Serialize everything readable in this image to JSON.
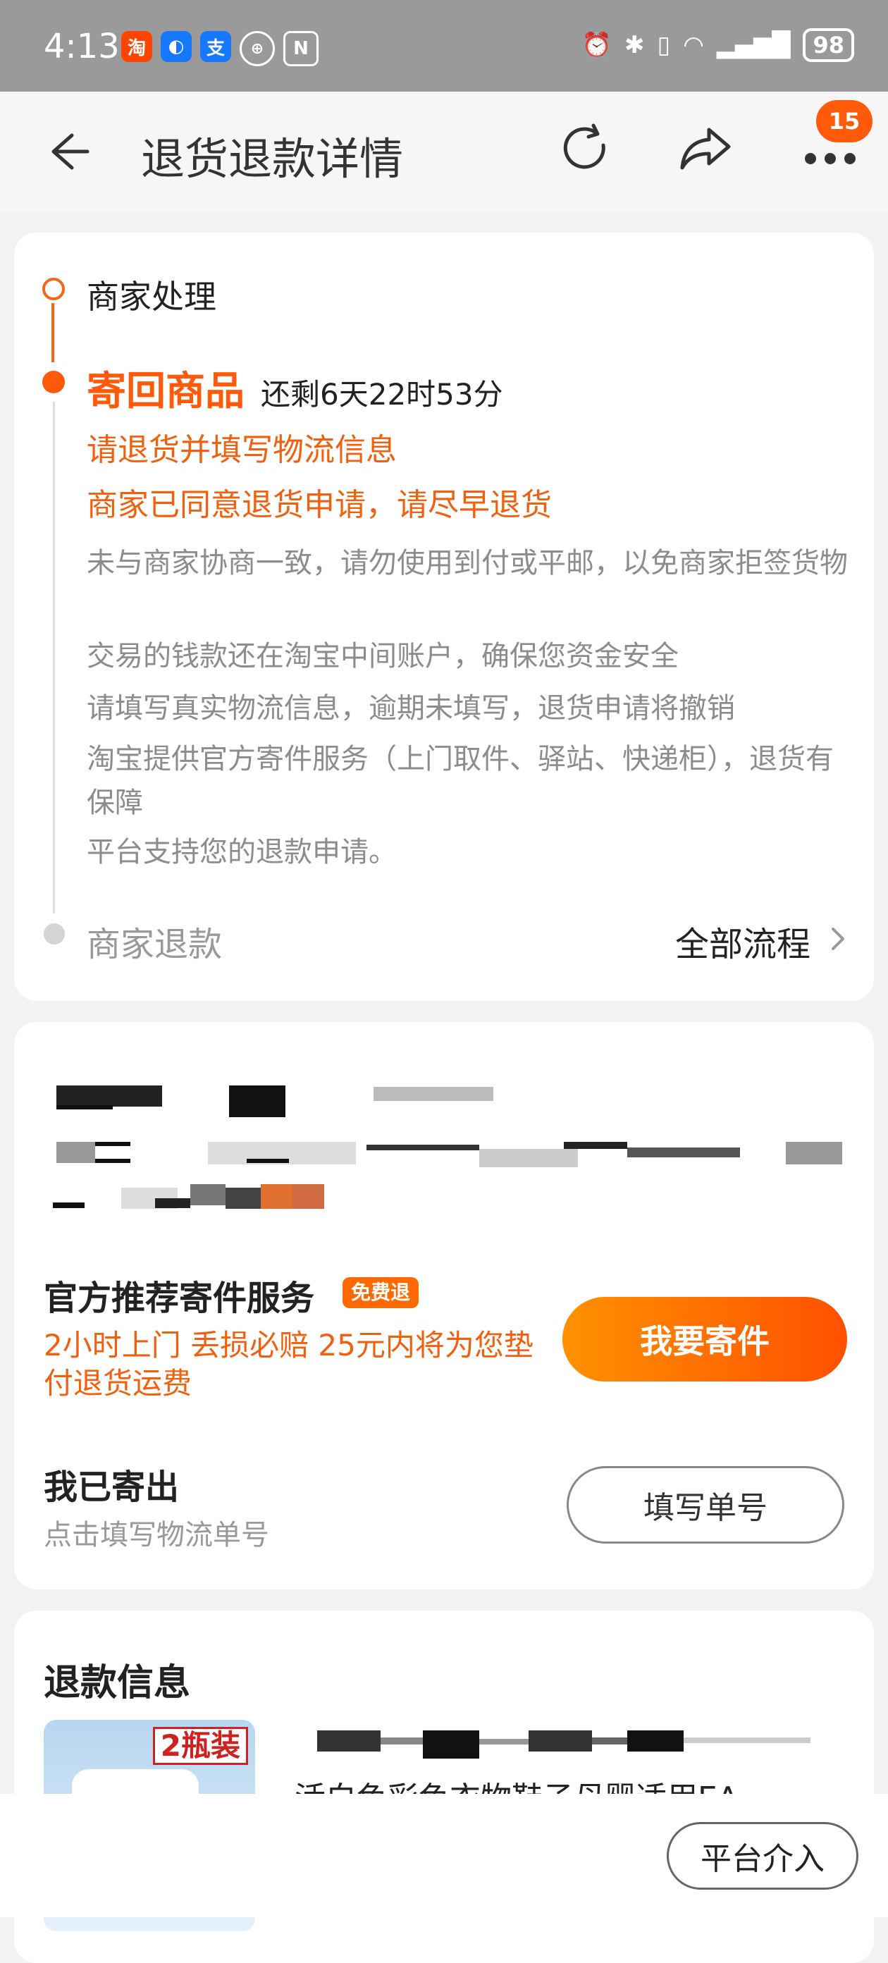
{
  "status_bar": {
    "time": "4:13",
    "battery": "98",
    "apps": [
      {
        "icon": "taobao-icon",
        "label": "淘",
        "color": "#ff4400"
      },
      {
        "icon": "app-blue-icon",
        "label": "",
        "color": "#1677ff"
      },
      {
        "icon": "alipay-icon",
        "label": "支",
        "color": "#1677ff"
      }
    ]
  },
  "header": {
    "title": "退货退款详情",
    "badge": "15"
  },
  "progress": {
    "step1": "商家处理",
    "step2": "寄回商品",
    "countdown": "还剩6天22时53分",
    "notice1": "请退货并填写物流信息",
    "notice2": "商家已同意退货申请，请尽早退货",
    "tips": [
      "未与商家协商一致，请勿使用到付或平邮，以免商家拒签货物",
      "交易的钱款还在淘宝中间账户，确保您资金安全",
      "请填写真实物流信息，逾期未填写，退货申请将撤销",
      "淘宝提供官方寄件服务（上门取件、驿站、快递柜），退货有保障",
      "平台支持您的退款申请。"
    ],
    "step3": "商家退款",
    "all_flow": "全部流程"
  },
  "shipping": {
    "service_title": "官方推荐寄件服务",
    "free_badge": "免费退",
    "service_desc": "2小时上门 丢损必赔 25元内将为您垫付退货运费",
    "ship_button": "我要寄件",
    "sent_title": "我已寄出",
    "sent_sub": "点击填写物流单号",
    "fill_button": "填写单号"
  },
  "refund": {
    "title": "退款信息",
    "thumb_badge": "2瓶装",
    "product_name": "活白色彩色衣物鞋子母婴适用EA"
  },
  "footer": {
    "platform_button": "平台介入"
  }
}
